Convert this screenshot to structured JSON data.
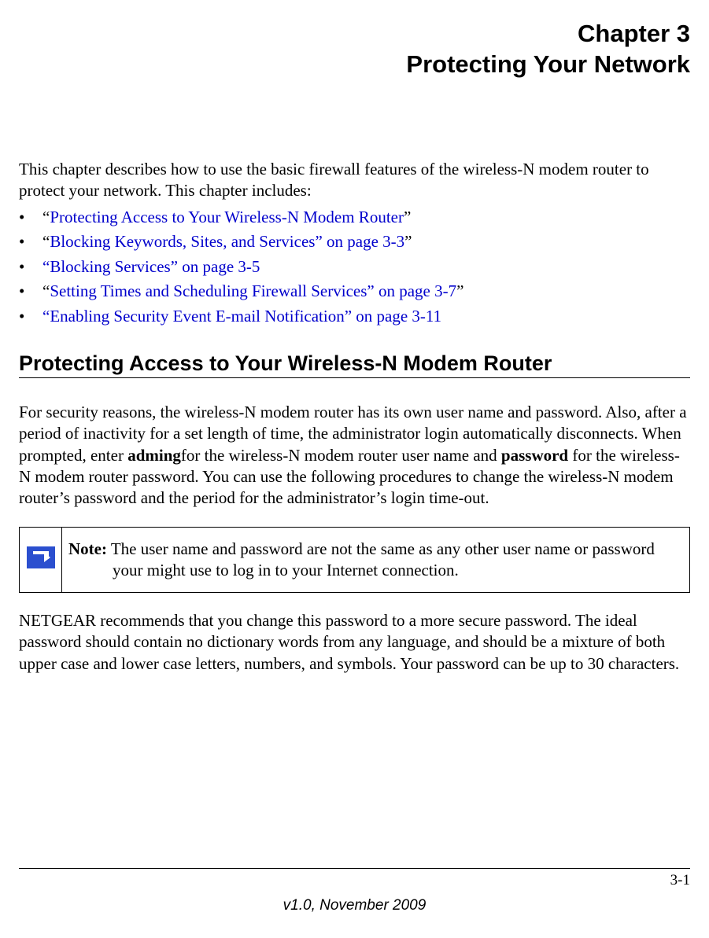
{
  "chapter": {
    "number_line": "Chapter 3",
    "title_line": "Protecting Your Network"
  },
  "intro": "This chapter describes how to use the basic firewall features of the wireless-N modem router to protect your network. This chapter includes:",
  "toc": [
    {
      "prefix": "“",
      "link": "Protecting Access to Your Wireless-N Modem Router",
      "suffix": "”"
    },
    {
      "prefix": "“",
      "link": "Blocking Keywords, Sites, and Services” on page 3-3",
      "suffix": "”"
    },
    {
      "prefix": "",
      "link": "“Blocking Services” on page 3-5",
      "suffix": ""
    },
    {
      "prefix": "“",
      "link": "Setting Times and Scheduling Firewall Services” on page 3-7",
      "suffix": "”"
    },
    {
      "prefix": "",
      "link": "“Enabling Security Event E-mail Notification” on page 3-11",
      "suffix": ""
    }
  ],
  "section_heading": "Protecting Access to Your Wireless-N Modem Router",
  "para1": {
    "pre": "For security reasons, the wireless-N modem router has its own user name and password. Also, after a period of inactivity for a set length of time, the administrator login automatically disconnects. When prompted, enter ",
    "bold1": "adming",
    "mid1": "for the wireless-N modem router user name and ",
    "bold2": "password",
    "post": " for the wireless-N modem router password. You can use the following procedures to change the wireless-N modem router’s password and the period for the administrator’s login time-out."
  },
  "note": {
    "label": "Note:",
    "text": " The user name and password are not the same as any other user name or password your might use to log in to your Internet connection."
  },
  "para2": "NETGEAR recommends that you change this password to a more secure password. The ideal password should contain no dictionary words from any language, and should be a mixture of both upper case and lower case letters, numbers, and symbols. Your password can be up to 30 characters.",
  "footer": {
    "page": "3-1",
    "version": "v1.0, November 2009"
  }
}
